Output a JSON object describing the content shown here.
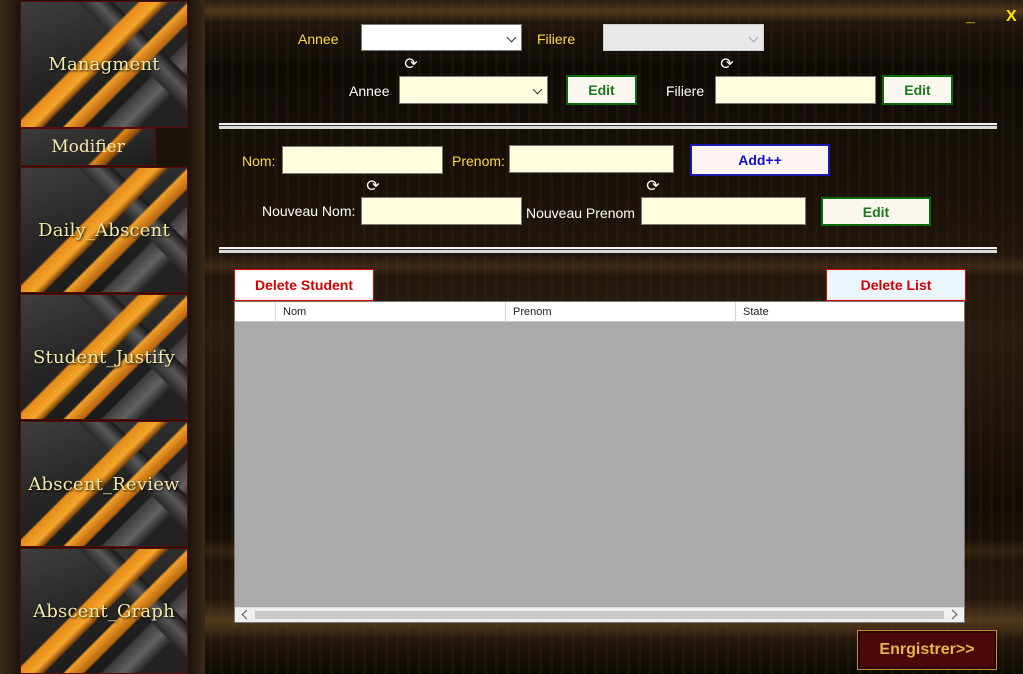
{
  "window": {
    "minimize_label": "_",
    "close_label": "X"
  },
  "sidebar": {
    "items": [
      {
        "label": "Managment"
      },
      {
        "label": "Modifier"
      },
      {
        "label": "Daily_Abscent"
      },
      {
        "label": "Student_Justify"
      },
      {
        "label": "Abscent_Review"
      },
      {
        "label": "Abscent_Graph"
      }
    ]
  },
  "filter": {
    "annee_label": "Annee",
    "annee_value": "",
    "filiere_label": "Filiere",
    "filiere_value": ""
  },
  "edit_annee": {
    "label": "Annee",
    "value": "",
    "button": "Edit",
    "filiere_label": "Filiere",
    "filiere_value": "",
    "filiere_button": "Edit"
  },
  "student": {
    "nom_label": "Nom:",
    "nom_value": "",
    "prenom_label": "Prenom:",
    "prenom_value": "",
    "add_button": "Add++",
    "nouveau_nom_label": "Nouveau Nom:",
    "nouveau_nom_value": "",
    "nouveau_prenom_label": "Nouveau Prenom",
    "nouveau_prenom_value": "",
    "edit_button": "Edit"
  },
  "actions": {
    "delete_student": "Delete Student",
    "delete_list": "Delete List"
  },
  "table": {
    "columns": [
      "Nom",
      "Prenom",
      "State"
    ],
    "rows": []
  },
  "footer": {
    "save_button": "Enrgistrer>>"
  }
}
